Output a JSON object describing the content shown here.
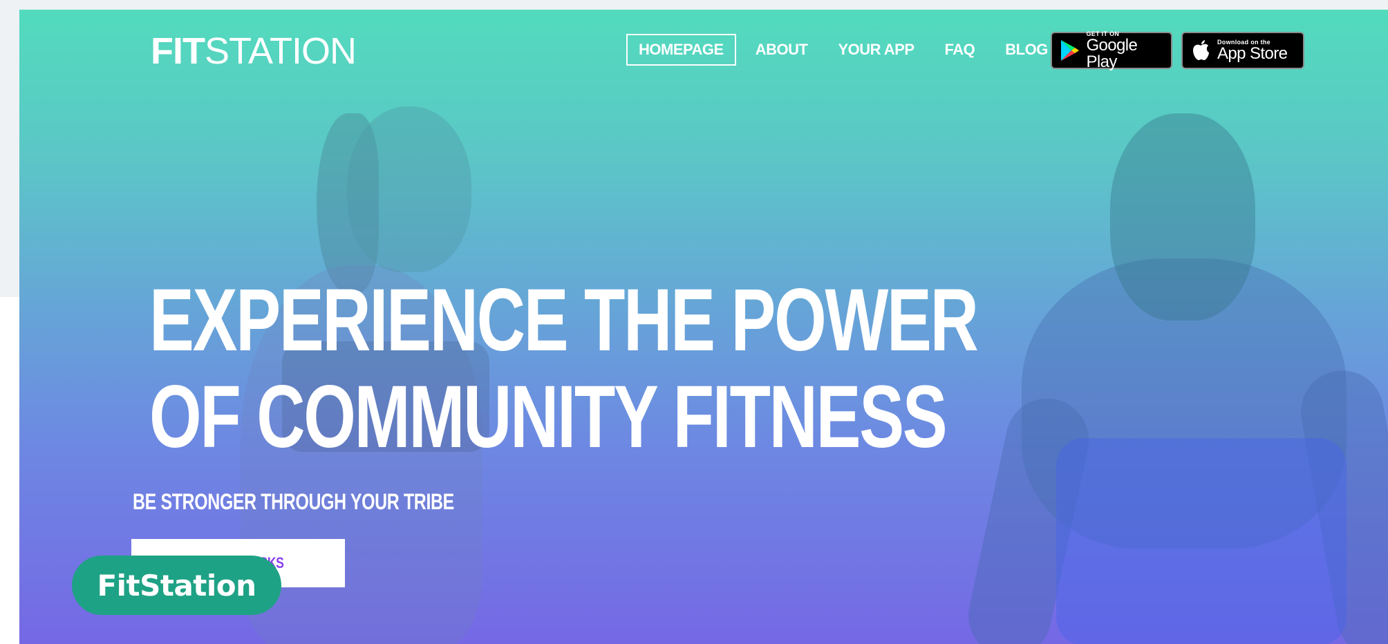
{
  "logo": {
    "bold": "FIT",
    "light": "STATION"
  },
  "nav": {
    "items": [
      {
        "label": "HOMEPAGE",
        "active": true
      },
      {
        "label": "ABOUT",
        "active": false
      },
      {
        "label": "YOUR APP",
        "active": false
      },
      {
        "label": "FAQ",
        "active": false
      },
      {
        "label": "BLOG",
        "active": false
      }
    ]
  },
  "stores": {
    "google": {
      "small": "GET IT ON",
      "big": "Google Play",
      "icon": "google-play-icon"
    },
    "apple": {
      "small": "Download on the",
      "big": "App Store",
      "icon": "apple-icon"
    }
  },
  "hero": {
    "headline_line1": "EXPERIENCE THE POWER",
    "headline_line2": "OF COMMUNITY FITNESS",
    "subline": "BE STRONGER THROUGH YOUR TRIBE",
    "cta_label": "HOW IT WORKS"
  },
  "badge": {
    "label": "FitStation"
  },
  "colors": {
    "gradient_top": "#52dbbd",
    "gradient_bottom": "#7568e5",
    "cta_text": "#8a3df0",
    "badge_bg": "#1ea285"
  }
}
